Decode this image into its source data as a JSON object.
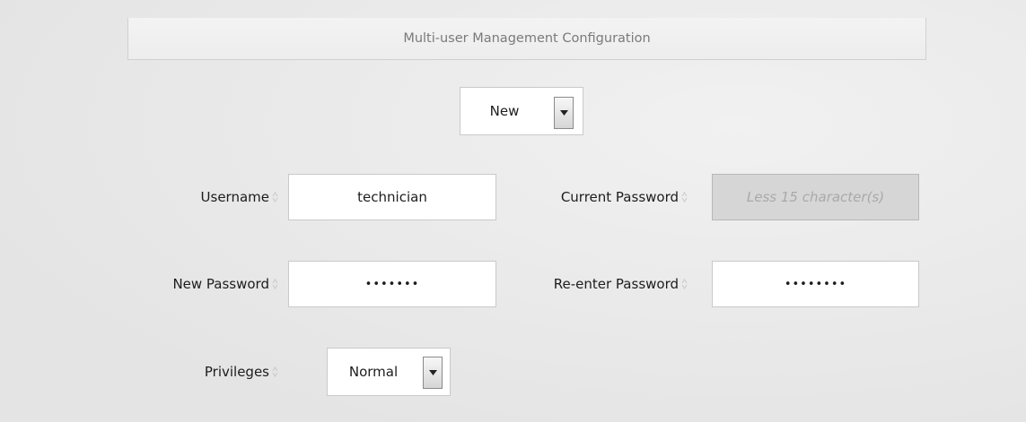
{
  "section": {
    "title": "Multi-user Management Configuration"
  },
  "mode_select": {
    "selected": "New"
  },
  "fields": {
    "username": {
      "label": "Username",
      "value": "technician"
    },
    "current_password": {
      "label": "Current Password",
      "placeholder": "Less 15 character(s)",
      "disabled": true
    },
    "new_password": {
      "label": "New Password",
      "value": "•••••••"
    },
    "reenter_password": {
      "label": "Re-enter Password",
      "value": "••••••••"
    },
    "privileges": {
      "label": "Privileges",
      "selected": "Normal"
    }
  },
  "icons": {
    "dropdown_arrow": "caret-down-icon",
    "sort_indicator": "sort-arrows-icon"
  },
  "colors": {
    "background": "#ebebeb",
    "header_text": "#7a7a7a",
    "disabled_field": "#d6d6d6",
    "placeholder_text": "#a9a9a9"
  }
}
